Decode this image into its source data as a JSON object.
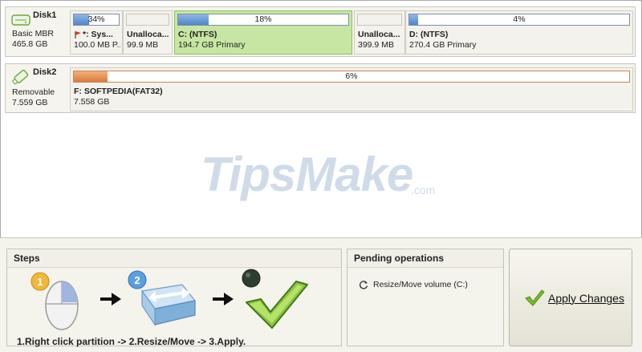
{
  "disks": [
    {
      "name": "Disk1",
      "type": "Basic MBR",
      "size": "465.8 GB",
      "partitions": [
        {
          "used_label": "34%",
          "used_fraction": 0.34,
          "name": "*: Sys...",
          "size": "100.0 MB P...",
          "selected": false,
          "style": "blue",
          "flag": true
        },
        {
          "used_label": "",
          "used_fraction": 0,
          "name": "Unalloca...",
          "size": "99.9 MB",
          "selected": false,
          "style": "empty"
        },
        {
          "used_label": "18%",
          "used_fraction": 0.18,
          "name": "C: (NTFS)",
          "size": "194.7 GB Primary",
          "selected": true,
          "style": "blue"
        },
        {
          "used_label": "",
          "used_fraction": 0,
          "name": "Unalloca...",
          "size": "399.9 MB",
          "selected": false,
          "style": "empty"
        },
        {
          "used_label": "4%",
          "used_fraction": 0.04,
          "name": "D: (NTFS)",
          "size": "270.4 GB Primary",
          "selected": false,
          "style": "blue"
        }
      ]
    },
    {
      "name": "Disk2",
      "type": "Removable",
      "size": "7.559 GB",
      "partitions": [
        {
          "used_label": "6%",
          "used_fraction": 0.06,
          "name": "F: SOFTPEDIA(FAT32)",
          "size": "7.558 GB",
          "selected": false,
          "style": "orange"
        }
      ]
    }
  ],
  "watermark": {
    "brand": "TipsMake",
    "suffix": ".com"
  },
  "steps": {
    "title": "Steps",
    "numbers": [
      "1",
      "2"
    ],
    "caption": "1.Right click partition -> 2.Resize/Move -> 3.Apply."
  },
  "pending": {
    "title": "Pending operations",
    "items": [
      "Resize/Move volume (C:)"
    ]
  },
  "apply_button": {
    "label": "Apply Changes"
  },
  "colors": {
    "selected_partition": "#c7e6a3",
    "used_fill": "#4f86c8",
    "removable_fill": "#db7b3c",
    "check_green": "#7cbf2a"
  },
  "icons": {
    "disk1": "hard-disk-icon",
    "disk2": "usb-drive-icon",
    "step1": "mouse-icon",
    "step2": "resize-drive-icon",
    "step3": "check-icon",
    "pending": "refresh-icon"
  }
}
